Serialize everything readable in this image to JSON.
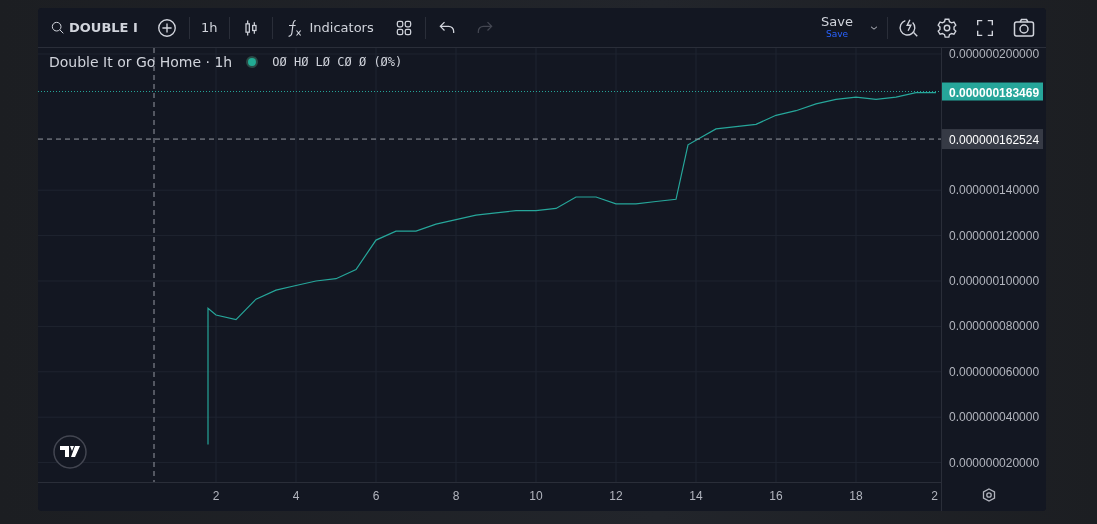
{
  "toolbar": {
    "symbol": "DOUBLE I",
    "interval": "1h",
    "indicators": "Indicators",
    "save": {
      "label": "Save",
      "status": "Save"
    },
    "undo": {
      "disabled": false
    },
    "redo": {
      "disabled": true
    }
  },
  "legend": {
    "title": "Double It or Go Home · 1h",
    "values": "OØ HØ LØ CØ Ø (Ø%)"
  },
  "chart_data": {
    "type": "line",
    "x": [
      1.8,
      1.8,
      2,
      2.5,
      3,
      3.5,
      4,
      4.5,
      5,
      5.5,
      6,
      6.5,
      7,
      7.5,
      8,
      8.5,
      9,
      9.5,
      10,
      10.5,
      11,
      11.5,
      12,
      12.5,
      13,
      13.5,
      13.8,
      14,
      14.5,
      15,
      15.5,
      16,
      16.5,
      17,
      17.5,
      18,
      18.5,
      19,
      19.5,
      20
    ],
    "series": [
      {
        "color": "#26a69a",
        "values": [
          2.8e-08,
          8.8e-08,
          8.5e-08,
          8.3e-08,
          9.2e-08,
          9.6e-08,
          9.8e-08,
          1e-07,
          1.01e-07,
          1.05e-07,
          1.18e-07,
          1.22e-07,
          1.22e-07,
          1.25e-07,
          1.27e-07,
          1.29e-07,
          1.3e-07,
          1.31e-07,
          1.31e-07,
          1.32e-07,
          1.37e-07,
          1.37e-07,
          1.34e-07,
          1.34e-07,
          1.35e-07,
          1.36e-07,
          1.6e-07,
          1.62e-07,
          1.67e-07,
          1.68e-07,
          1.69e-07,
          1.73e-07,
          1.75e-07,
          1.78e-07,
          1.8e-07,
          1.81e-07,
          1.8e-07,
          1.81e-07,
          1.83e-07,
          1.83e-07
        ]
      }
    ],
    "grid": true,
    "xlim": [
      -2.45,
      20.125
    ],
    "ylim": [
      1.145e-08,
      2.0264e-07
    ],
    "xticks": [
      2,
      4,
      6,
      8,
      10,
      12,
      14,
      16,
      18
    ],
    "yticks": [
      {
        "value": 2e-08,
        "label": "0.000000020000"
      },
      {
        "value": 4e-08,
        "label": "0.000000040000"
      },
      {
        "value": 6e-08,
        "label": "0.000000060000"
      },
      {
        "value": 8e-08,
        "label": "0.000000080000"
      },
      {
        "value": 1e-07,
        "label": "0.000000100000"
      },
      {
        "value": 1.2e-07,
        "label": "0.000000120000"
      },
      {
        "value": 1.4e-07,
        "label": "0.000000140000"
      },
      {
        "value": 2e-07,
        "label": "0.000000200000"
      }
    ],
    "ref_lines": [
      {
        "axis": "y",
        "value": 1.83469e-07,
        "label": "0.000000183469"
      },
      {
        "axis": "y",
        "value": 1.62524e-07,
        "label": "0.000000162524"
      },
      {
        "axis": "x",
        "value": 0.45
      }
    ]
  },
  "time_axis_edge_label": "2"
}
